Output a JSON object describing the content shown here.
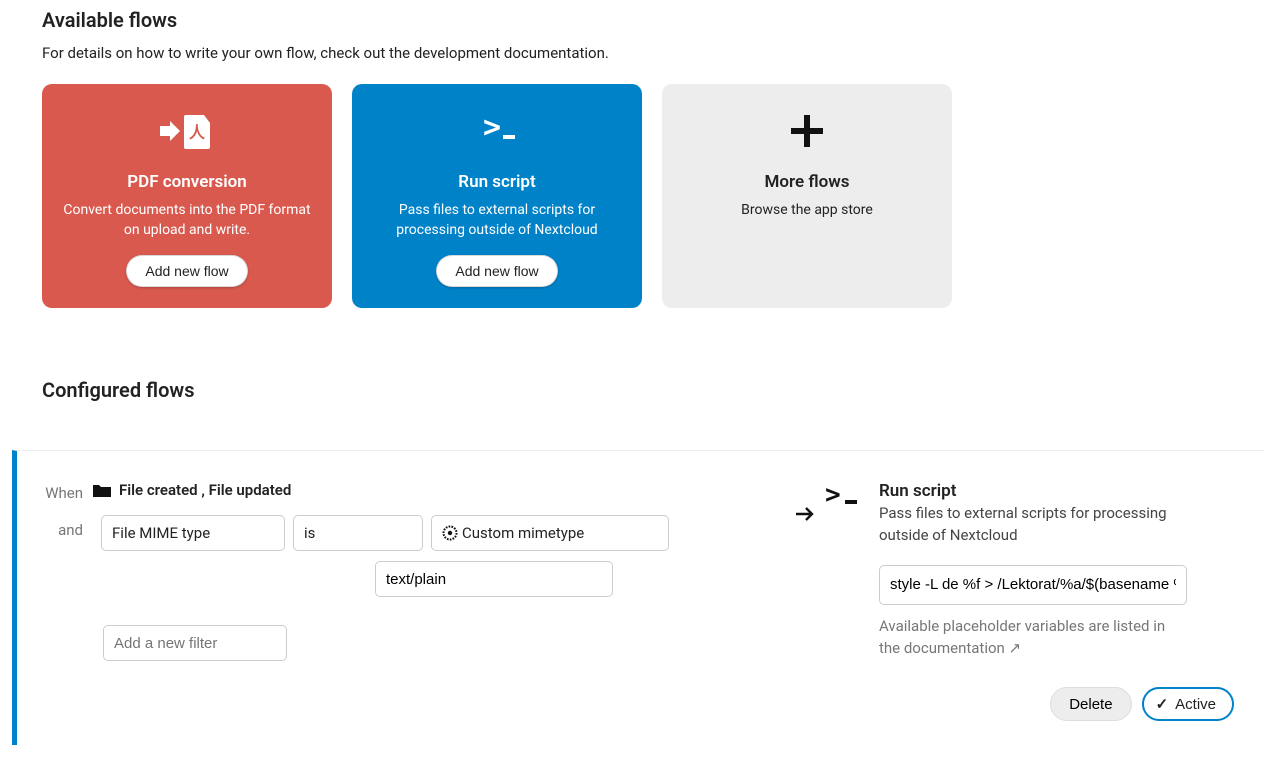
{
  "available": {
    "title": "Available flows",
    "subtitle": "For details on how to write your own flow, check out the development documentation.",
    "cards": [
      {
        "title": "PDF conversion",
        "desc": "Convert documents into the PDF format on upload and write.",
        "button": "Add new flow"
      },
      {
        "title": "Run script",
        "desc": "Pass files to external scripts for processing outside of Nextcloud",
        "button": "Add new flow"
      },
      {
        "title": "More flows",
        "desc": "Browse the app store"
      }
    ]
  },
  "configured": {
    "title": "Configured flows",
    "flow": {
      "when_label": "When",
      "and_label": "and",
      "events_text": "File created ,   File updated",
      "mime_field": "File MIME type",
      "operator": "is",
      "mime_mode": "Custom mimetype",
      "mime_value": "text/plain",
      "add_filter_placeholder": "Add a new filter",
      "action": {
        "title": "Run script",
        "desc": "Pass files to external scripts for processing outside of Nextcloud",
        "script": "style -L de %f > /Lektorat/%a/$(basename %n).st",
        "note": "Available placeholder variables are listed in the documentation ↗"
      },
      "footer": {
        "delete": "Delete",
        "active": "Active"
      }
    }
  }
}
